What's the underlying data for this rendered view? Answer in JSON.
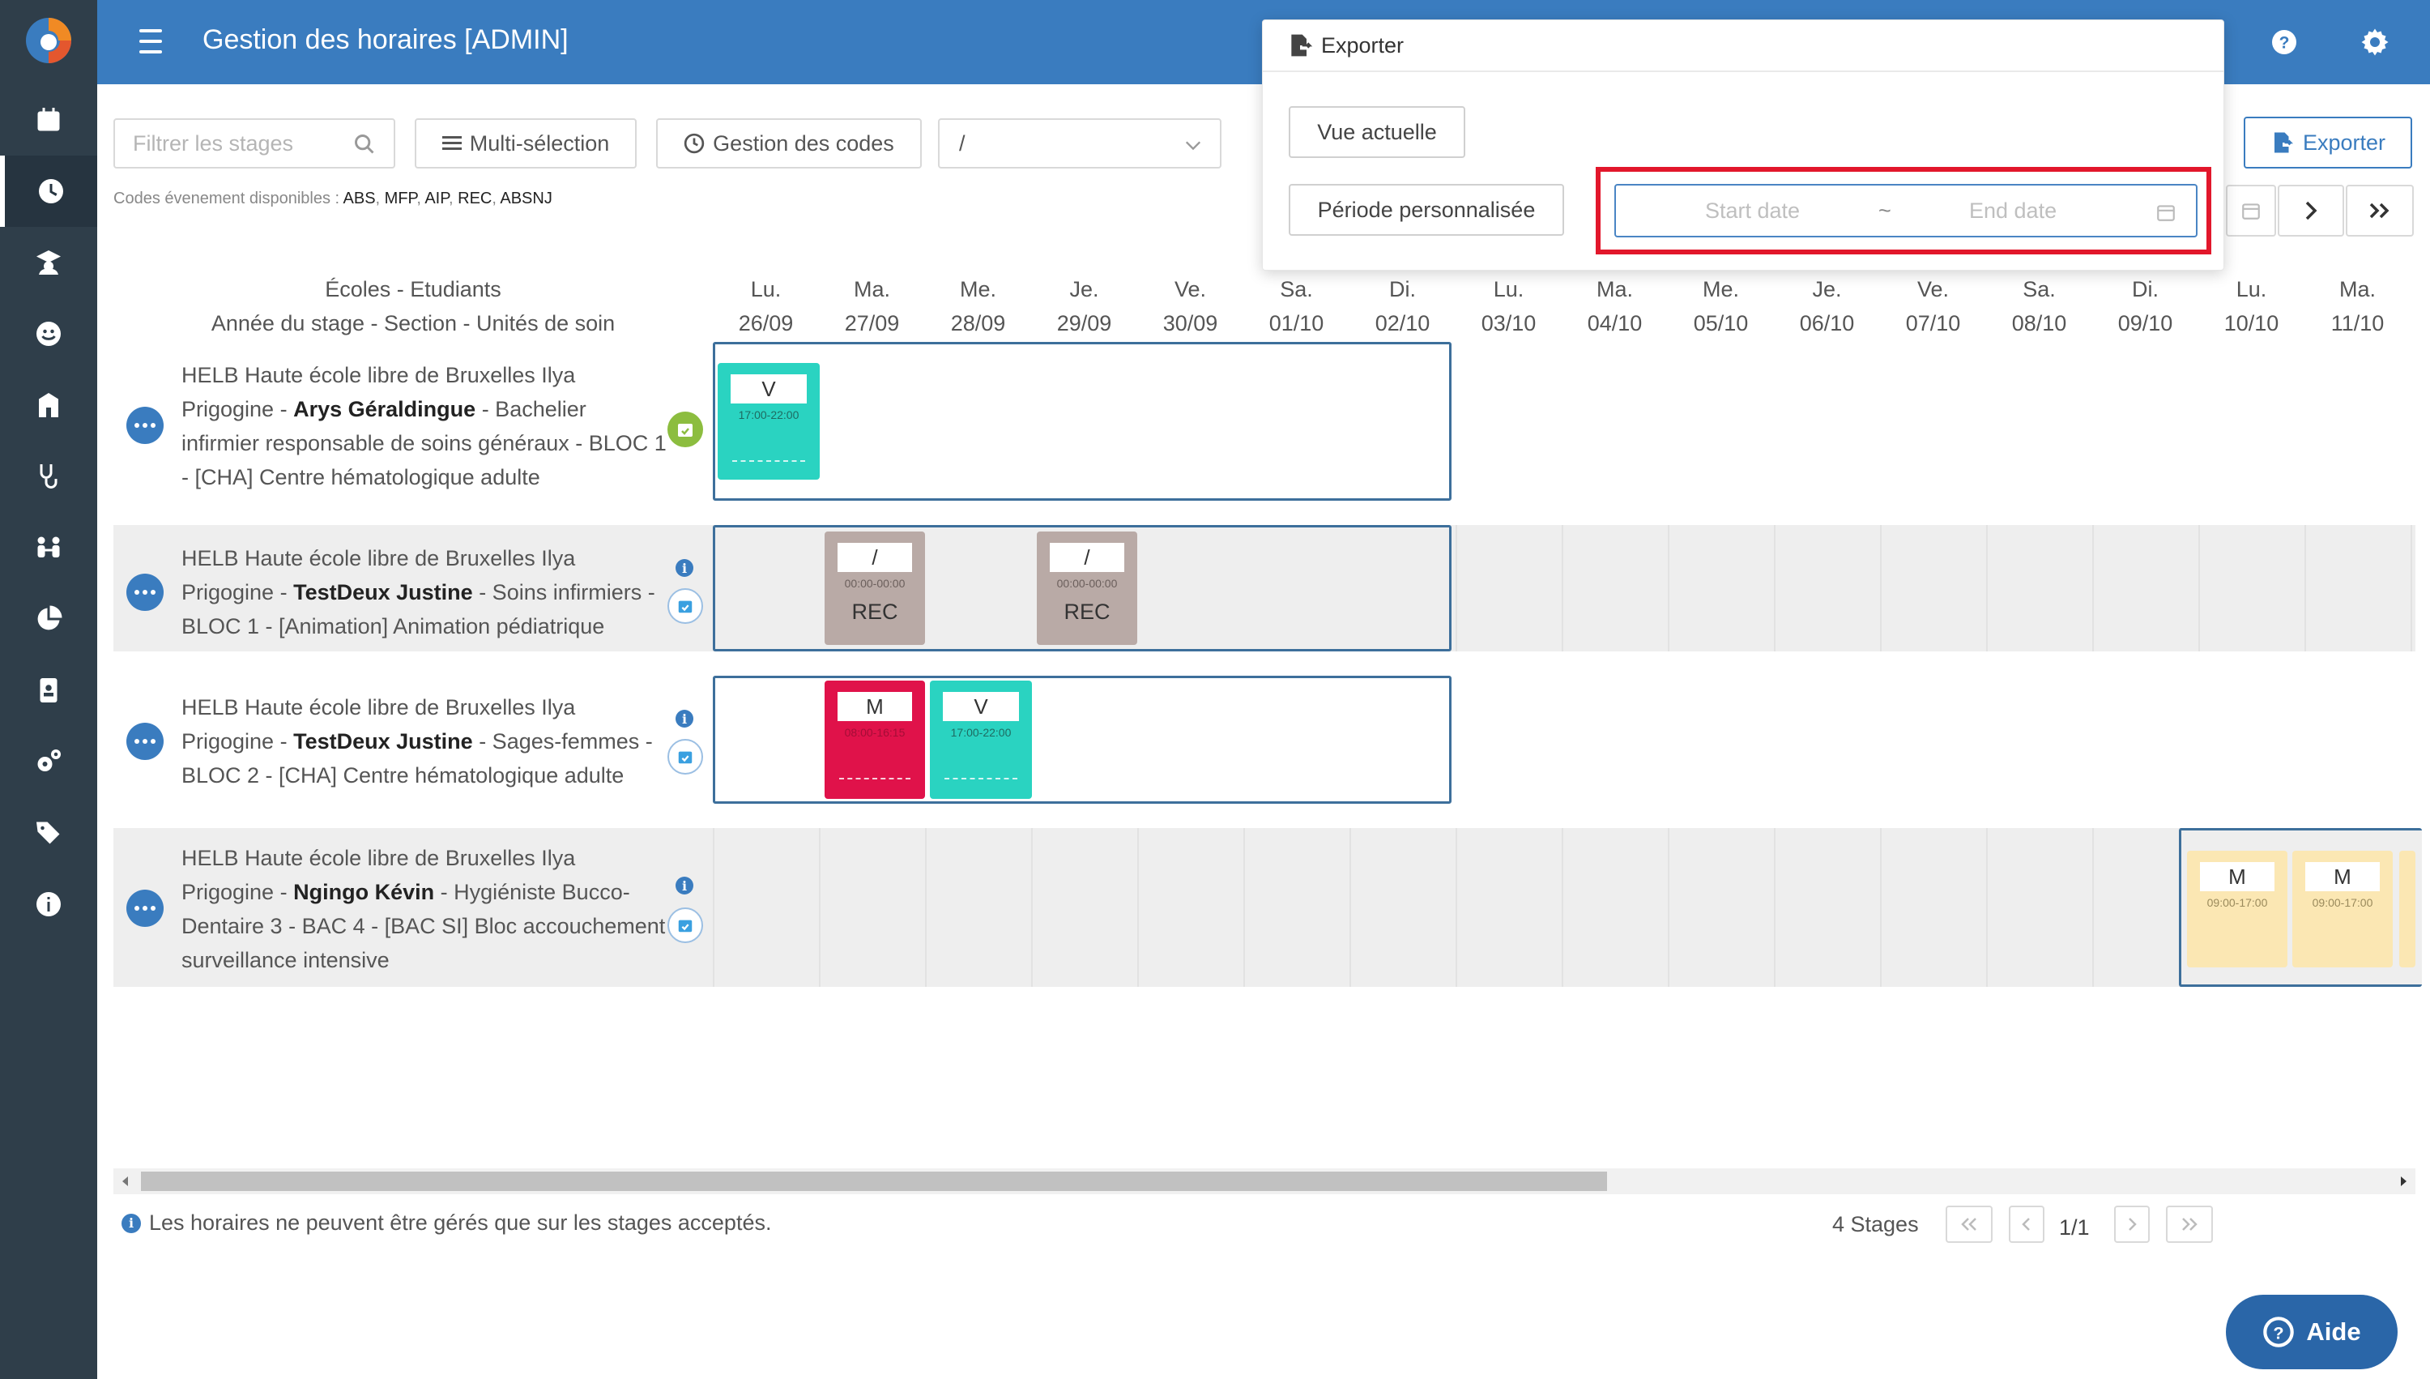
{
  "header": {
    "title": "Gestion des horaires [ADMIN]"
  },
  "toolbar": {
    "filter_placeholder": "Filtrer les stages",
    "multi_label": "Multi-sélection",
    "codes_label": "Gestion des codes",
    "select_value": "/",
    "codes_prefix": "Codes évenement disponibles :",
    "codes": [
      "ABS",
      "MFP",
      "AIP",
      "REC",
      "ABSNJ"
    ],
    "export_label": "Exporter"
  },
  "grid": {
    "header_line1": "Écoles - Etudiants",
    "header_line2": "Année du stage - Section - Unités de soin",
    "days": [
      {
        "d": "Lu.",
        "date": "26/09"
      },
      {
        "d": "Ma.",
        "date": "27/09"
      },
      {
        "d": "Me.",
        "date": "28/09"
      },
      {
        "d": "Je.",
        "date": "29/09"
      },
      {
        "d": "Ve.",
        "date": "30/09"
      },
      {
        "d": "Sa.",
        "date": "01/10"
      },
      {
        "d": "Di.",
        "date": "02/10"
      },
      {
        "d": "Lu.",
        "date": "03/10"
      },
      {
        "d": "Ma.",
        "date": "04/10"
      },
      {
        "d": "Me.",
        "date": "05/10"
      },
      {
        "d": "Je.",
        "date": "06/10"
      },
      {
        "d": "Ve.",
        "date": "07/10"
      },
      {
        "d": "Sa.",
        "date": "08/10"
      },
      {
        "d": "Di.",
        "date": "09/10"
      },
      {
        "d": "Lu.",
        "date": "10/10"
      },
      {
        "d": "Ma.",
        "date": "11/10"
      }
    ],
    "rows": [
      {
        "school": "HELB Haute école libre de Bruxelles Ilya Prigogine -",
        "name": "Arys Géraldingue",
        "rest": "- Bachelier infirmier responsable de soins généraux - BLOC 1 - [CHA] Centre hématologique adulte"
      },
      {
        "school": "HELB Haute école libre de Bruxelles Ilya Prigogine -",
        "name": "TestDeux Justine",
        "rest": "- Soins infirmiers - BLOC 1 - [Animation] Animation pédiatrique"
      },
      {
        "school": "HELB Haute école libre de Bruxelles Ilya Prigogine -",
        "name": "TestDeux Justine",
        "rest": "- Sages-femmes - BLOC 2 - [CHA] Centre hématologique adulte"
      },
      {
        "school": "HELB Haute école libre de Bruxelles Ilya Prigogine -",
        "name": "Ngingo Kévin",
        "rest": "- Hygiéniste Bucco-Dentaire 3 - BAC 4 - [BAC SI] Bloc accouchement surveillance intensive"
      }
    ],
    "cells": [
      {
        "label": "V",
        "time": "17:00-22:00",
        "code": "",
        "color": "#2ad3c1"
      },
      {
        "label": "/",
        "time": "00:00-00:00",
        "code": "REC",
        "color": "#b9aaa6"
      },
      {
        "label": "/",
        "time": "00:00-00:00",
        "code": "REC",
        "color": "#b9aaa6"
      },
      {
        "label": "M",
        "time": "08:00-16:15",
        "code": "",
        "color": "#e0124a"
      },
      {
        "label": "V",
        "time": "17:00-22:00",
        "code": "",
        "color": "#2ad3c1"
      },
      {
        "label": "M",
        "time": "09:00-17:00",
        "code": "",
        "color": "#fbe7b3"
      },
      {
        "label": "M",
        "time": "09:00-17:00",
        "code": "",
        "color": "#fbe7b3"
      }
    ]
  },
  "footer": {
    "note": "Les horaires ne peuvent être gérés que sur les stages acceptés.",
    "count": "4 Stages",
    "page": "1/1",
    "help": "Aide"
  },
  "popover": {
    "title": "Exporter",
    "current_view": "Vue actuelle",
    "custom_period": "Période personnalisée",
    "start_placeholder": "Start date",
    "separator": "~",
    "end_placeholder": "End date"
  },
  "icons": {
    "sidebar": [
      "calendar-icon",
      "clock-icon",
      "graduate-icon",
      "smile-icon",
      "school-icon",
      "stethoscope-icon",
      "people-icon",
      "pie-chart-icon",
      "id-card-icon",
      "cogs-icon",
      "tags-icon",
      "info-icon"
    ]
  },
  "colors": {
    "primary": "#3a7cbf",
    "sidebar": "#2f3e4a",
    "highlight": "#e2172b"
  }
}
